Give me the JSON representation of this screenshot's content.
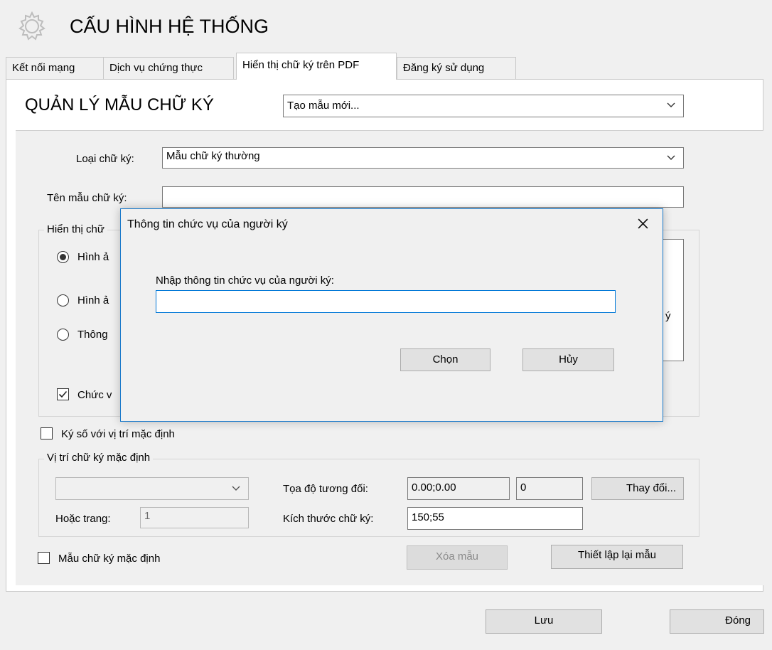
{
  "window": {
    "title": "CẤU HÌNH HỆ THỐNG",
    "icon": "gear-icon"
  },
  "tabs": [
    {
      "label": "Kết nối mạng",
      "active": false
    },
    {
      "label": "Dịch vụ chứng thực",
      "active": false
    },
    {
      "label": "Hiển thị chữ ký trên PDF",
      "active": true
    },
    {
      "label": "Đăng ký sử dụng",
      "active": false
    }
  ],
  "template_manager": {
    "title": "QUẢN LÝ MẪU CHỮ KÝ",
    "template_select": "Tạo mẫu mới..."
  },
  "form": {
    "signature_type_label": "Loại chữ ký:",
    "signature_type_value": "Mẫu chữ ký thường",
    "template_name_label": "Tên mẫu chữ ký:",
    "template_name_value": "",
    "display_group_legend": "Hiển thị chữ",
    "radio_1": "Hình ả",
    "radio_2": "Hình ả",
    "radio_3": "Thông",
    "position_check": "Chức v",
    "preview_fragment": "ý"
  },
  "default_position": {
    "sign_default_check": "Ký số với vị trí mặc định",
    "legend": "Vị trí chữ ký mặc định",
    "relative_coord_label": "Tọa độ tương đối:",
    "relative_coord_value": "0.00;0.00",
    "coord_extra_value": "0",
    "change_button": "Thay đổi...",
    "or_page_label": "Hoặc trang:",
    "or_page_value": "1",
    "size_label": "Kích thước chữ ký:",
    "size_value": "150;55"
  },
  "bottom": {
    "default_template_check": "Mẫu chữ ký mặc định",
    "delete_button": "Xóa mẫu",
    "reset_button": "Thiết lập lại mẫu",
    "save_button": "Lưu",
    "close_button": "Đóng"
  },
  "dialog": {
    "title": "Thông tin chức vụ của người ký",
    "prompt": "Nhập thông tin chức vụ của người ký:",
    "input_value": "",
    "ok_button": "Chọn",
    "cancel_button": "Hủy"
  },
  "colors": {
    "dialog_border": "#1979ca",
    "accent": "#0078d7"
  }
}
